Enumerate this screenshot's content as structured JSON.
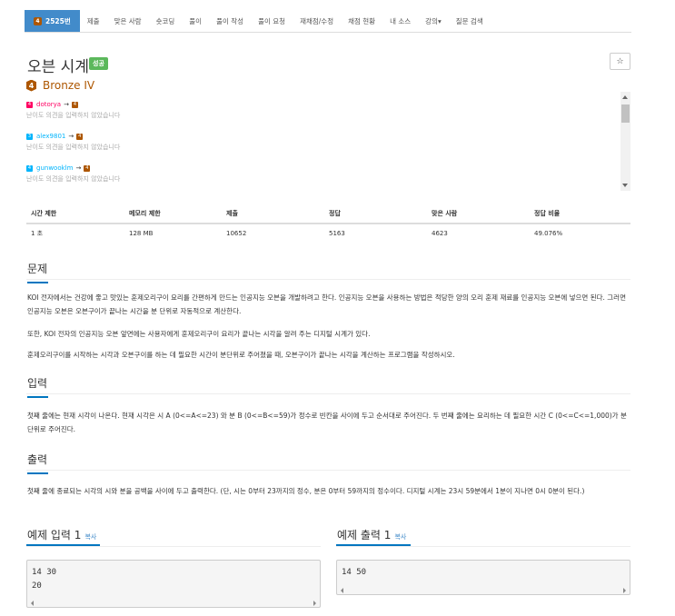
{
  "tabs": [
    {
      "label": "2525번",
      "badge": "4"
    },
    {
      "label": "제출"
    },
    {
      "label": "맞은 사람"
    },
    {
      "label": "숏코딩"
    },
    {
      "label": "풀이"
    },
    {
      "label": "풀이 작성"
    },
    {
      "label": "풀이 요청"
    },
    {
      "label": "재채점/수정"
    },
    {
      "label": "채점 현황"
    },
    {
      "label": "내 소스"
    },
    {
      "label": "강의▾"
    },
    {
      "label": "질문 검색"
    }
  ],
  "problem": {
    "title": "오븐 시계",
    "status": "성공",
    "star": "☆",
    "tier_badge": "4",
    "tier": "Bronze IV"
  },
  "contributors": [
    {
      "badge": "4",
      "user": "dotorya",
      "to_badge": "4",
      "note": "난이도 의견을 입력하지 않았습니다"
    },
    {
      "badge": "3",
      "user": "alex9801",
      "to_badge": "4",
      "note": "난이도 의견을 입력하지 않았습니다"
    },
    {
      "badge": "4",
      "user": "gunwooklm",
      "to_badge": "4",
      "note": "난이도 의견을 입력하지 않았습니다"
    }
  ],
  "arrow": "→",
  "stats": {
    "headers": [
      "시간 제한",
      "메모리 제한",
      "제출",
      "정답",
      "맞은 사람",
      "정답 비율"
    ],
    "values": [
      "1 초",
      "128 MB",
      "10652",
      "5163",
      "4623",
      "49.076%"
    ]
  },
  "sections": {
    "problem_title": "문제",
    "problem_p1": "KOI 전자에서는 건강에 좋고 맛있는 훈제오리구이 요리를 간편하게 만드는 인공지능 오븐을 개발하려고 한다. 인공지능 오븐을 사용하는 방법은 적당한 양의 오리 훈제 재료를 인공지능 오븐에 넣으면 된다. 그러면 인공지능 오븐은  오븐구이가 끝나는 시간을 분 단위로 자동적으로 계산한다.",
    "problem_p2": "또한, KOI 전자의 인공지능 오븐 앞면에는 사용자에게 훈제오리구이 요리가 끝나는 시각을 알려 주는 디지털 시계가 있다.",
    "problem_p3": "훈제오리구이를 시작하는 시각과 오븐구이를 하는 데 필요한 시간이 분단위로 주어졌을 때, 오븐구이가 끝나는 시각을 계산하는 프로그램을 작성하시오.",
    "input_title": "입력",
    "input_p": "첫째 줄에는 현재 시각이 나온다. 현재 시각은 시 A (0<=A<=23) 와 분 B (0<=B<=59)가 정수로 빈칸을 사이에 두고 순서대로 주어진다. 두 번째 줄에는 요리하는 데 필요한 시간 C  (0<=C<=1,000)가 분 단위로 주어진다.",
    "output_title": "출력",
    "output_p": "첫째 줄에 종료되는 시각의 시와 분을 공백을 사이에 두고 출력한다. (단, 시는 0부터 23까지의 정수, 분은 0부터 59까지의 정수이다. 디지털 시계는 23시 59분에서 1분이 지나면 0시 0분이 된다.)"
  },
  "samples": {
    "input_title": "예제 입력 1",
    "output_title": "예제 출력 1",
    "copy": "복사",
    "input_line1": "14 30",
    "input_line2": "20",
    "output_line1": "14 50"
  }
}
